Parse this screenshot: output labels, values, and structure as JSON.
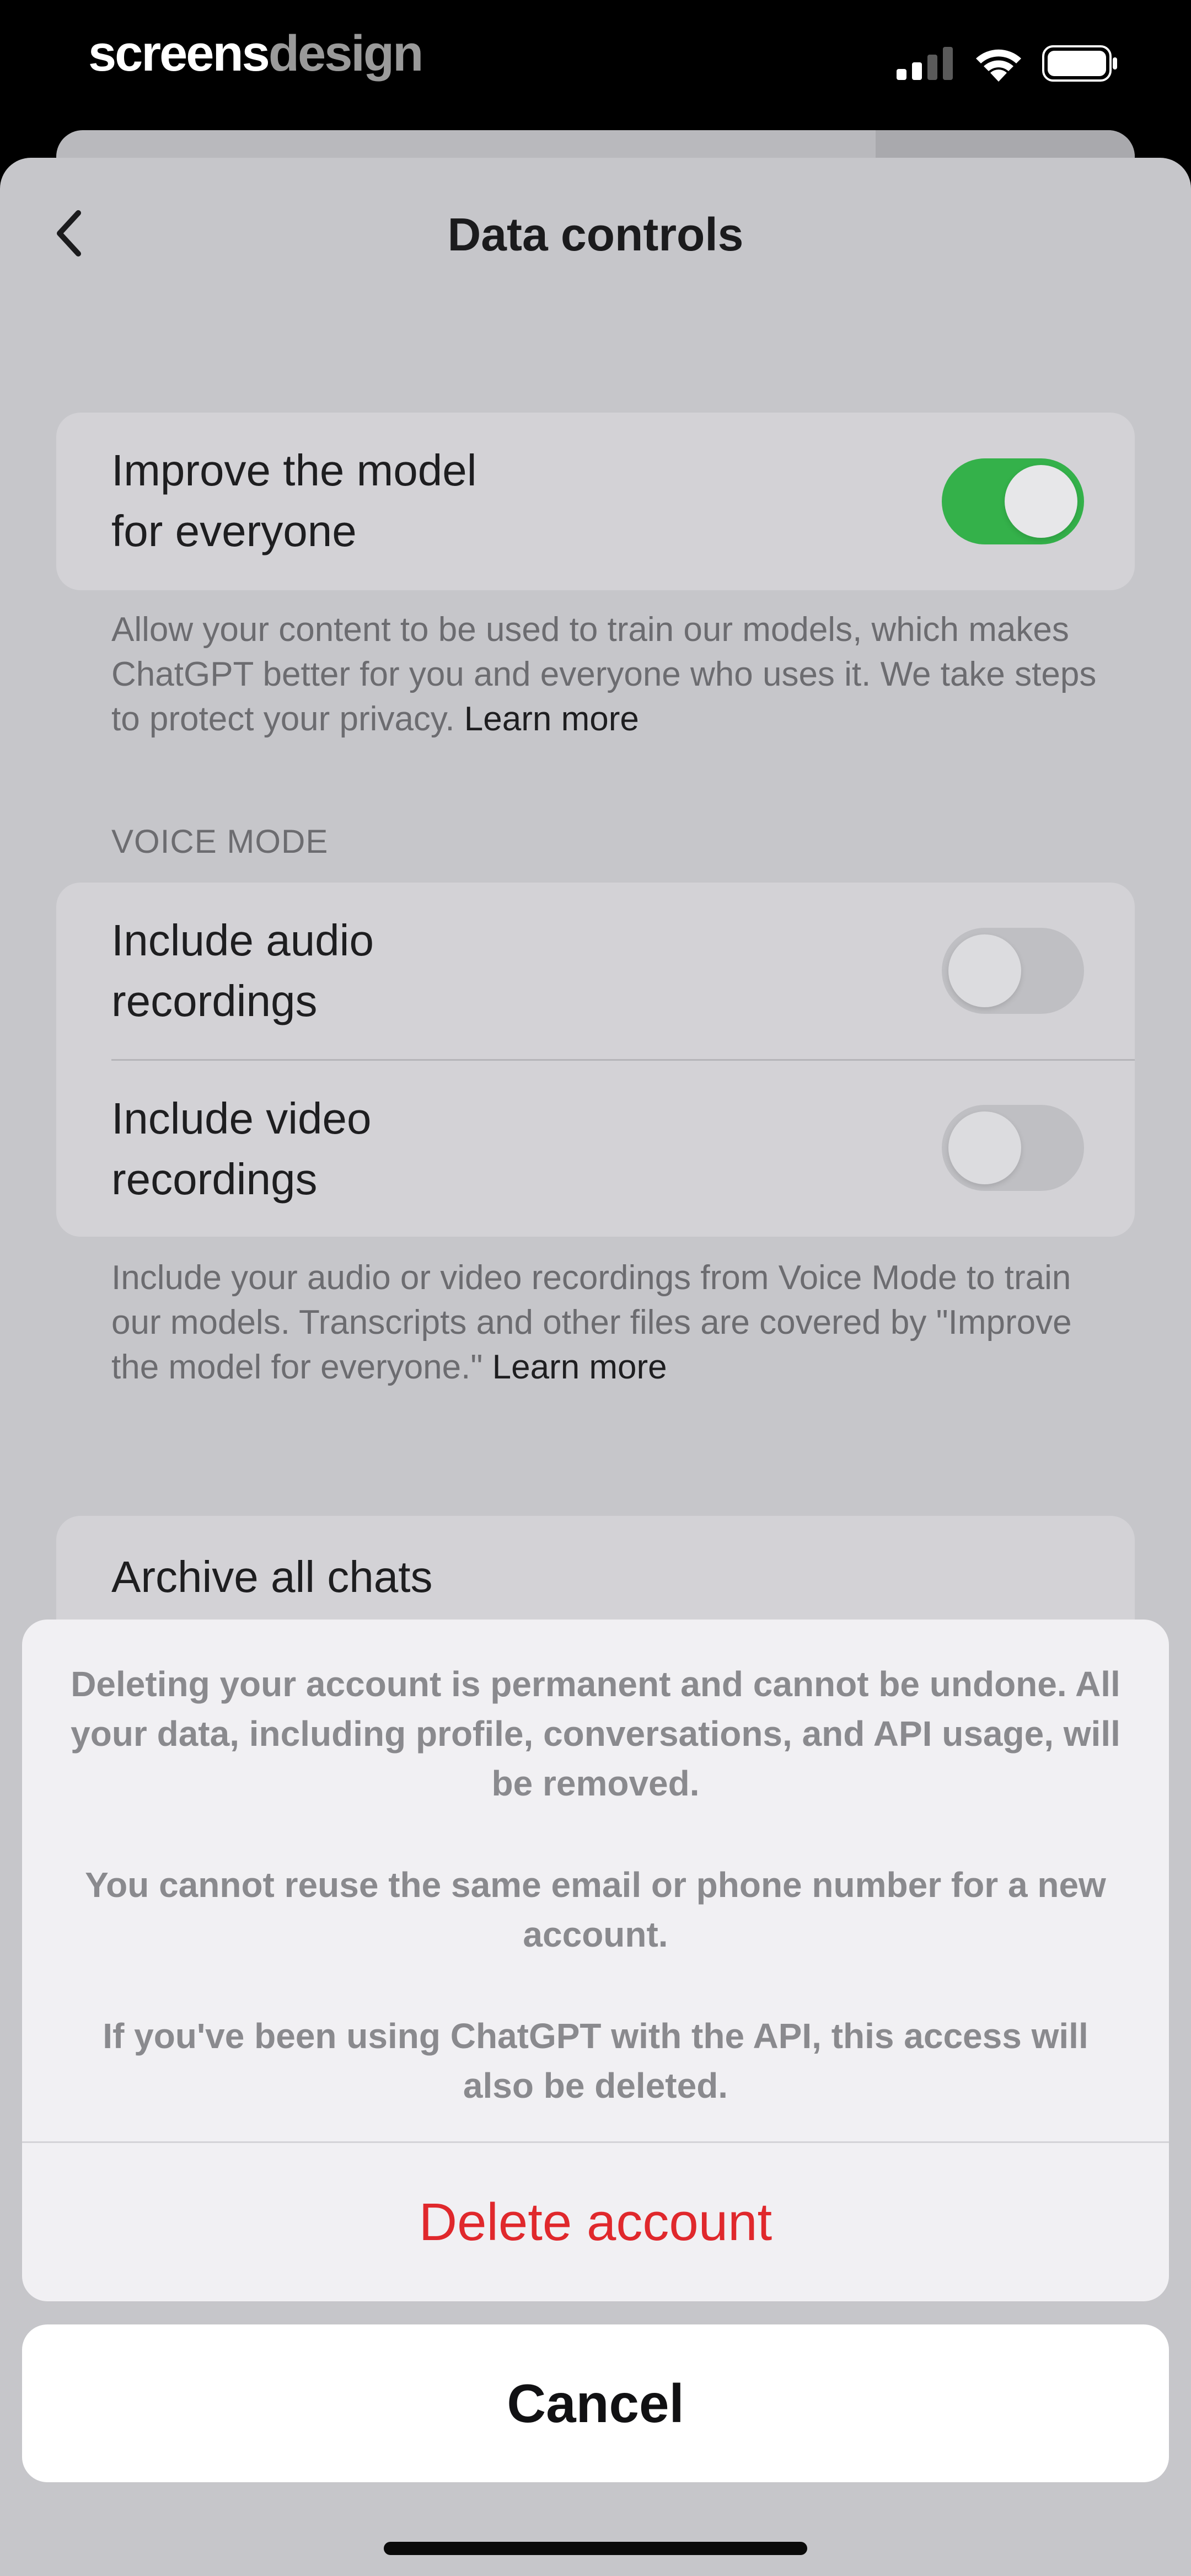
{
  "status_bar": {
    "watermark_part1": "screens",
    "watermark_part2": "design",
    "icons": [
      "signal-icon",
      "wifi-icon",
      "battery-icon"
    ]
  },
  "nav": {
    "back_icon": "chevron-left-icon",
    "title": "Data controls"
  },
  "improve_model": {
    "label_line1": "Improve the model",
    "label_line2": "for everyone",
    "enabled": true,
    "footnote": "Allow your content to be used to train our models, which makes ChatGPT better for you and everyone who uses it. We take steps to protect your privacy.",
    "footnote_link": "Learn more"
  },
  "voice_mode": {
    "header": "VOICE MODE",
    "audio": {
      "label_line1": "Include audio",
      "label_line2": "recordings",
      "enabled": false
    },
    "video": {
      "label_line1": "Include video",
      "label_line2": "recordings",
      "enabled": false
    },
    "footnote": "Include your audio or video recordings from Voice Mode to train our models. Transcripts and other files are covered by \"Improve the model for everyone.\"",
    "footnote_link": "Learn more"
  },
  "archive": {
    "label": "Archive all chats"
  },
  "action_sheet": {
    "message_1": "Deleting your account is permanent and cannot be undone. All your data, including profile, conversations, and API usage, will be removed.",
    "message_2": "You cannot reuse the same email or phone number for a new account.",
    "message_3": "If you've been using ChatGPT with the API, this access will also be deleted.",
    "delete_label": "Delete account",
    "cancel_label": "Cancel"
  },
  "colors": {
    "toggle_on": "#34b14a",
    "destructive": "#e0282c",
    "sheet_background": "#c6c6ca",
    "card_background": "#d3d2d6"
  }
}
